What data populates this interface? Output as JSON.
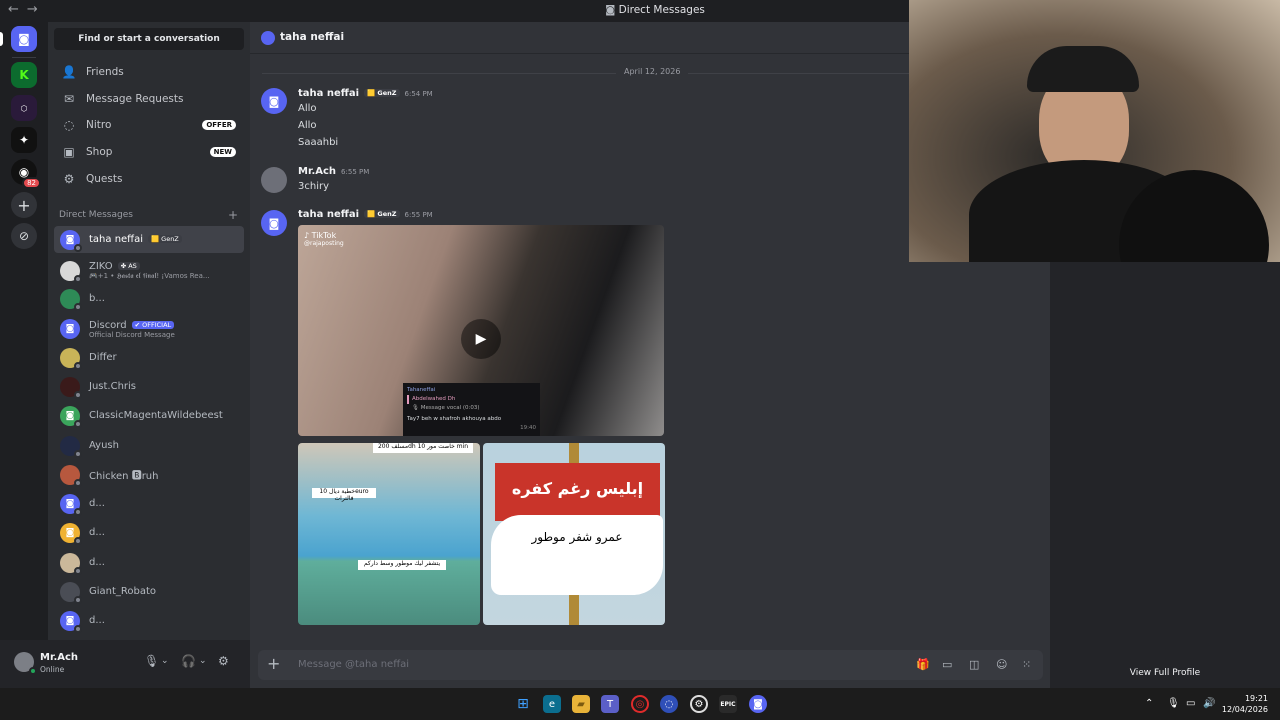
{
  "titlebar": {
    "back": "←",
    "forward": "→",
    "title": "Direct Messages"
  },
  "guild_badge": "82",
  "sidebar": {
    "search": "Find or start a conversation",
    "nav": [
      {
        "label": "Friends",
        "icon": "friends-icon"
      },
      {
        "label": "Message Requests",
        "icon": "mail-icon"
      },
      {
        "label": "Nitro",
        "icon": "nitro-icon",
        "pill": "OFFER"
      },
      {
        "label": "Shop",
        "icon": "shop-icon",
        "pill": "NEW"
      },
      {
        "label": "Quests",
        "icon": "quests-icon"
      }
    ],
    "dm_header": "Direct Messages",
    "dm_add": "+",
    "dms": [
      {
        "name": "taha neffai",
        "tag": "GenZ",
        "sub": "",
        "color": "#5865f2"
      },
      {
        "name": "ZIKO",
        "tag": "AS",
        "sub": "🎮+1 • 𝕳𝖆𝖘𝖙𝖆 𝖊𝖑 𝖋𝖎𝖓𝖆𝖑! ¡Vamos Rea...",
        "color": "#d8d8d8"
      },
      {
        "name": "b...",
        "tag": "",
        "sub": "",
        "color": "#2e8b57"
      },
      {
        "name": "Discord",
        "tag": "OFFICIAL",
        "sub": "Official Discord Message",
        "color": "#5865f2"
      },
      {
        "name": "Differ",
        "tag": "",
        "sub": "",
        "color": "#c9b458"
      },
      {
        "name": "Just.Chris",
        "tag": "",
        "sub": "",
        "color": "#3a1a1a"
      },
      {
        "name": "ClassicMagentaWildebeest",
        "tag": "",
        "sub": "",
        "color": "#3ba55c"
      },
      {
        "name": "Ayush",
        "tag": "",
        "sub": "",
        "color": "#222a44"
      },
      {
        "name": "Chicken 🅱ruh",
        "tag": "",
        "sub": "",
        "color": "#b7583e"
      },
      {
        "name": "d...",
        "tag": "",
        "sub": "",
        "color": "#5865f2"
      },
      {
        "name": "d...",
        "tag": "",
        "sub": "",
        "color": "#f0b232"
      },
      {
        "name": "d...",
        "tag": "",
        "sub": "",
        "color": "#cbb89a"
      },
      {
        "name": "Giant_Robato",
        "tag": "",
        "sub": "",
        "color": "#4a4d55"
      },
      {
        "name": "d...",
        "tag": "",
        "sub": "",
        "color": "#5865f2"
      }
    ]
  },
  "user": {
    "name": "Mr.Ach",
    "status": "Online"
  },
  "chat": {
    "header_name": "taha neffai",
    "date": "April 12, 2026",
    "messages": [
      {
        "author": "taha neffai",
        "tag": "GenZ",
        "time": "6:54 PM",
        "lines": [
          "Allo",
          "Allo",
          "Saaahbi"
        ]
      },
      {
        "author": "Mr.Ach",
        "tag": "",
        "time": "6:55 PM",
        "lines": [
          "3chiry"
        ]
      },
      {
        "author": "taha neffai",
        "tag": "GenZ",
        "time": "6:55 PM",
        "lines": []
      }
    ],
    "video": {
      "tiktok": "TikTok",
      "handle": "@rajaposting",
      "overlay_name": "Tahaneffai",
      "overlay_reply_to": "Abdelwahed Dh",
      "overlay_reply_text": "🎙 Message vocal (0:03)",
      "overlay_msg": "Tay7 beh w shafroh akhouya abdo",
      "overlay_time": "19:40"
    },
    "meme": {
      "top_caption": "مسلف 200dh خاصت مور 10 min",
      "mid_caption": "خطية ديال 10euro فالترات",
      "bottom_caption": "يتشفر ليك موطور وسط داركم",
      "sign_text": "إبليس رغم كفره",
      "paper_text": "عمرو شفر موطور"
    },
    "input_placeholder": "Message @taha neffai"
  },
  "profile": {
    "view_full": "View Full Profile"
  },
  "taskbar": {
    "time": "19:21",
    "date": "12/04/2026"
  }
}
